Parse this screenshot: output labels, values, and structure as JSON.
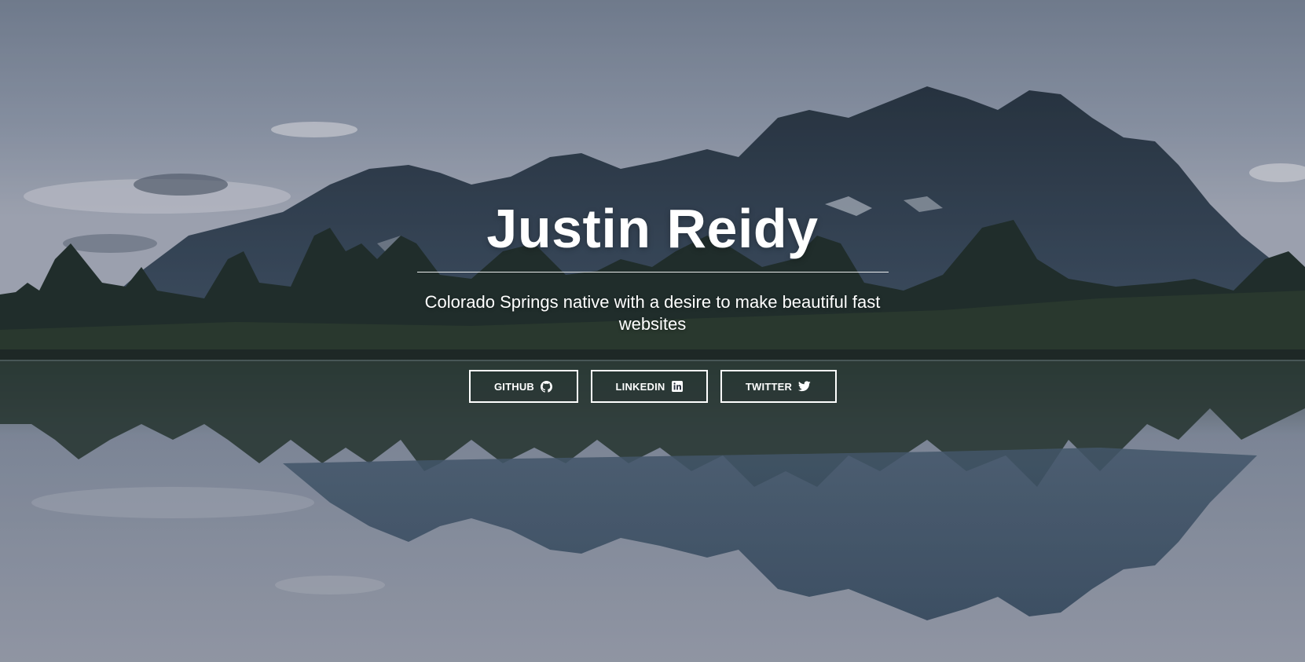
{
  "hero": {
    "title": "Justin Reidy",
    "subtitle": "Colorado Springs native with a desire to make beautiful fast websites"
  },
  "buttons": [
    {
      "label": "GITHUB",
      "icon": "github-icon"
    },
    {
      "label": "LINKEDIN",
      "icon": "linkedin-icon"
    },
    {
      "label": "TWITTER",
      "icon": "twitter-icon"
    }
  ],
  "colors": {
    "text": "#ffffff",
    "sky": "#9aa3b4",
    "mountains": "#2c3a4c",
    "trees": "#1f2f25",
    "water": "#8d96a8"
  }
}
